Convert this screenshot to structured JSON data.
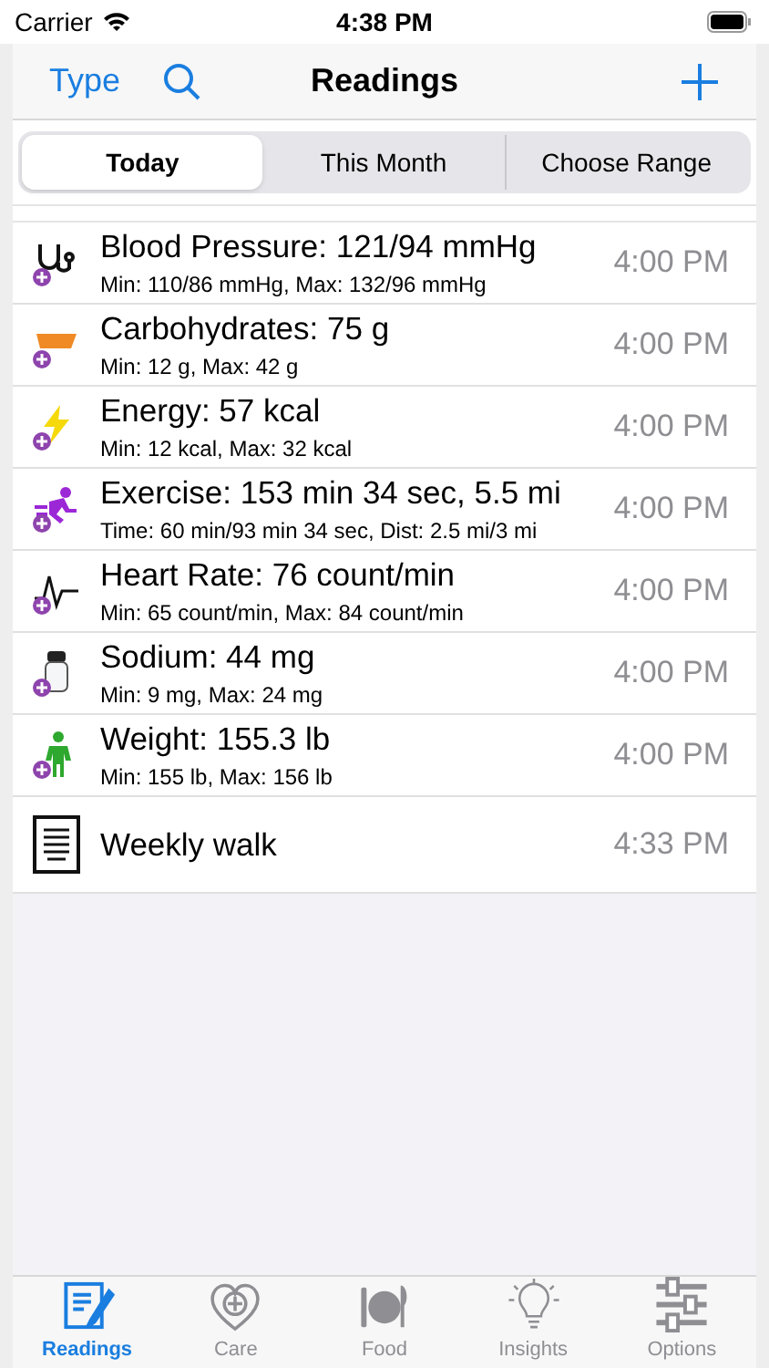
{
  "status_bar": {
    "carrier": "Carrier",
    "time": "4:38 PM"
  },
  "nav": {
    "left": "Type",
    "title": "Readings"
  },
  "segments": [
    {
      "label": "Today",
      "selected": true
    },
    {
      "label": "This Month",
      "selected": false
    },
    {
      "label": "Choose Range",
      "selected": false
    }
  ],
  "readings": [
    {
      "kind": "stethoscope",
      "title": "Blood Pressure: 121/94 mmHg",
      "detail": "Min: 110/86 mmHg, Max: 132/96 mmHg",
      "time": "4:00 PM"
    },
    {
      "kind": "bowl",
      "title": "Carbohydrates: 75 g",
      "detail": "Min: 12 g, Max: 42 g",
      "time": "4:00 PM"
    },
    {
      "kind": "bolt",
      "title": "Energy: 57 kcal",
      "detail": "Min: 12 kcal, Max: 32 kcal",
      "time": "4:00 PM"
    },
    {
      "kind": "runner",
      "title": "Exercise: 153 min 34 sec, 5.5 mi",
      "detail": "Time: 60 min/93 min 34 sec, Dist: 2.5 mi/3 mi",
      "time": "4:00 PM"
    },
    {
      "kind": "pulse",
      "title": "Heart Rate: 76 count/min",
      "detail": "Min: 65 count/min, Max: 84 count/min",
      "time": "4:00 PM"
    },
    {
      "kind": "shaker",
      "title": "Sodium: 44 mg",
      "detail": "Min: 9 mg, Max: 24 mg",
      "time": "4:00 PM"
    },
    {
      "kind": "person",
      "title": "Weight: 155.3 lb",
      "detail": "Min: 155 lb, Max: 156 lb",
      "time": "4:00 PM"
    },
    {
      "kind": "note",
      "title": "Weekly walk",
      "time": "4:33 PM"
    }
  ],
  "tab_bar": [
    {
      "kind": "notepad",
      "label": "Readings",
      "selected": true
    },
    {
      "kind": "heart",
      "label": "Care",
      "selected": false
    },
    {
      "kind": "plate",
      "label": "Food",
      "selected": false
    },
    {
      "kind": "bulb",
      "label": "Insights",
      "selected": false
    },
    {
      "kind": "sliders",
      "label": "Options",
      "selected": false
    }
  ]
}
